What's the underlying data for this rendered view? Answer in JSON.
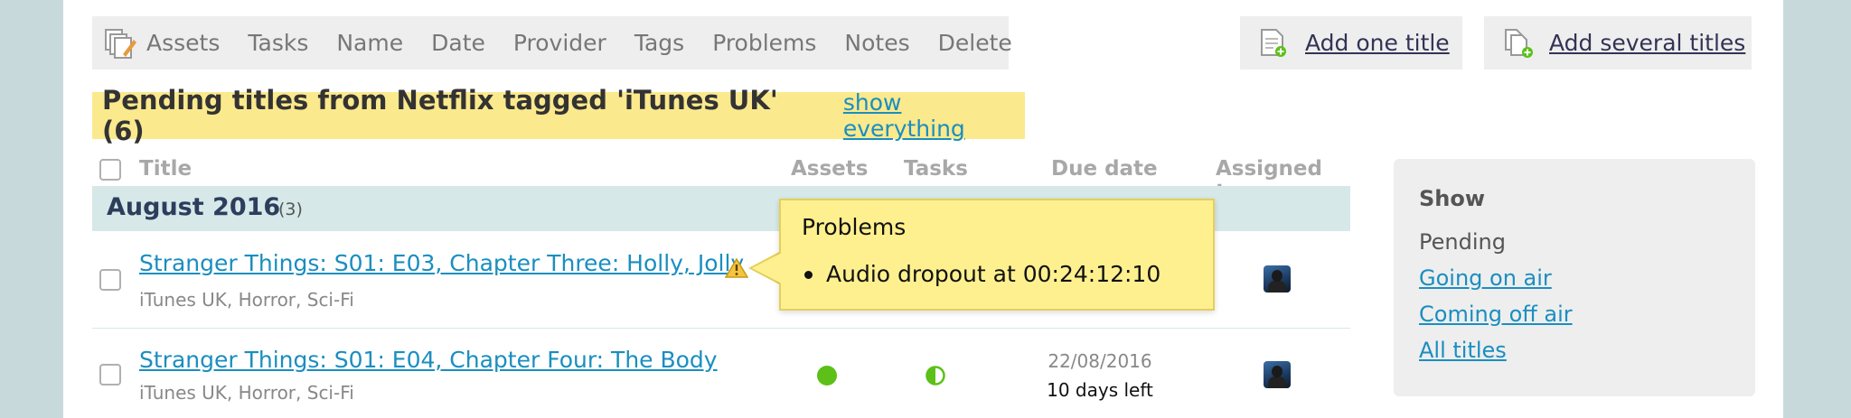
{
  "toolbar": {
    "icon": "bulk-edit-icon",
    "items": [
      "Assets",
      "Tasks",
      "Name",
      "Date",
      "Provider",
      "Tags",
      "Problems",
      "Notes",
      "Delete"
    ],
    "add_one": "Add one title",
    "add_several": "Add several titles"
  },
  "banner": {
    "title": "Pending titles from Netflix tagged 'iTunes UK' (6)",
    "link": "show everything"
  },
  "table": {
    "headers": {
      "title": "Title",
      "assets": "Assets",
      "tasks": "Tasks",
      "due": "Due date",
      "assigned": "Assigned to"
    },
    "group": {
      "label": "August 2016",
      "count": "(3)"
    },
    "rows": [
      {
        "title": "Stranger Things: S01: E03, Chapter Three: Holly, Jolly",
        "tags": "iTunes UK, Horror, Sci-Fi",
        "warning_icon": "warning-icon"
      },
      {
        "title": "Stranger Things: S01: E04, Chapter Four: The Body",
        "tags": "iTunes UK, Horror, Sci-Fi",
        "due_date": "22/08/2016",
        "days_left": "10 days left",
        "assets_status_color": "#5cc018",
        "tasks_status_color": "#5cc018"
      }
    ]
  },
  "tooltip": {
    "title": "Problems",
    "items": [
      "Audio dropout at 00:24:12:10"
    ]
  },
  "sidebar": {
    "heading": "Show",
    "current": "Pending",
    "links": [
      "Going on air",
      "Coming off air",
      "All titles"
    ]
  },
  "colors": {
    "accent_link": "#1a8ec0",
    "banner_bg": "#fbe98d",
    "group_bg": "#d6e8e8",
    "tooltip_bg": "#fff08f",
    "page_bg": "#c7d9db"
  }
}
